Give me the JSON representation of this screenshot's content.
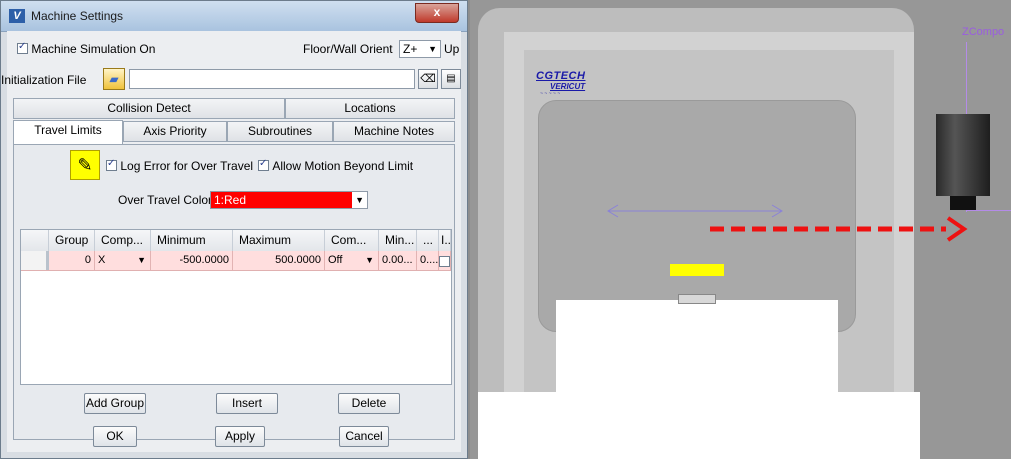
{
  "window": {
    "title": "Machine Settings",
    "icon": "vericut-v-icon",
    "close_glyph": "x"
  },
  "top": {
    "machine_sim_label": "Machine Simulation On",
    "machine_sim_checked": true,
    "floor_wall_label": "Floor/Wall Orient",
    "floor_wall_value": "Z+",
    "floor_wall_suffix": "Up",
    "init_file_label": "Initialization File",
    "init_file_value": ""
  },
  "tabs": {
    "row_top": [
      "Collision Detect",
      "Locations"
    ],
    "row_bottom": [
      "Travel Limits",
      "Axis Priority",
      "Subroutines",
      "Machine Notes"
    ],
    "active": "Travel Limits"
  },
  "travel": {
    "log_error_label": "Log Error for Over Travel",
    "log_error_checked": true,
    "allow_motion_label": "Allow Motion Beyond Limit",
    "allow_motion_checked": true,
    "color_label": "Over Travel Color",
    "color_value": "1:Red",
    "color_hex": "#ff0000"
  },
  "table": {
    "headers": [
      "Group",
      "Comp...",
      "Minimum",
      "Maximum",
      "Com...",
      "Min...",
      "...",
      "I..."
    ],
    "rows": [
      {
        "group": "0",
        "comp": "X",
        "minimum": "-500.0000",
        "maximum": "500.0000",
        "com": "Off",
        "min": "0.00...",
        "extra": "0....",
        "i_checked": false
      }
    ]
  },
  "table_buttons": {
    "add_group": "Add Group",
    "insert": "Insert",
    "delete": "Delete"
  },
  "footer_buttons": {
    "ok": "OK",
    "apply": "Apply",
    "cancel": "Cancel"
  },
  "viewport": {
    "logo_line1": "CGTECH",
    "logo_line2": "VERICUT",
    "logo_line3": "~ ~ ~ ~ ~",
    "axis_label": "ZCompo",
    "arrow_color": "#ee1111",
    "highlight_color": "#ffff00"
  }
}
